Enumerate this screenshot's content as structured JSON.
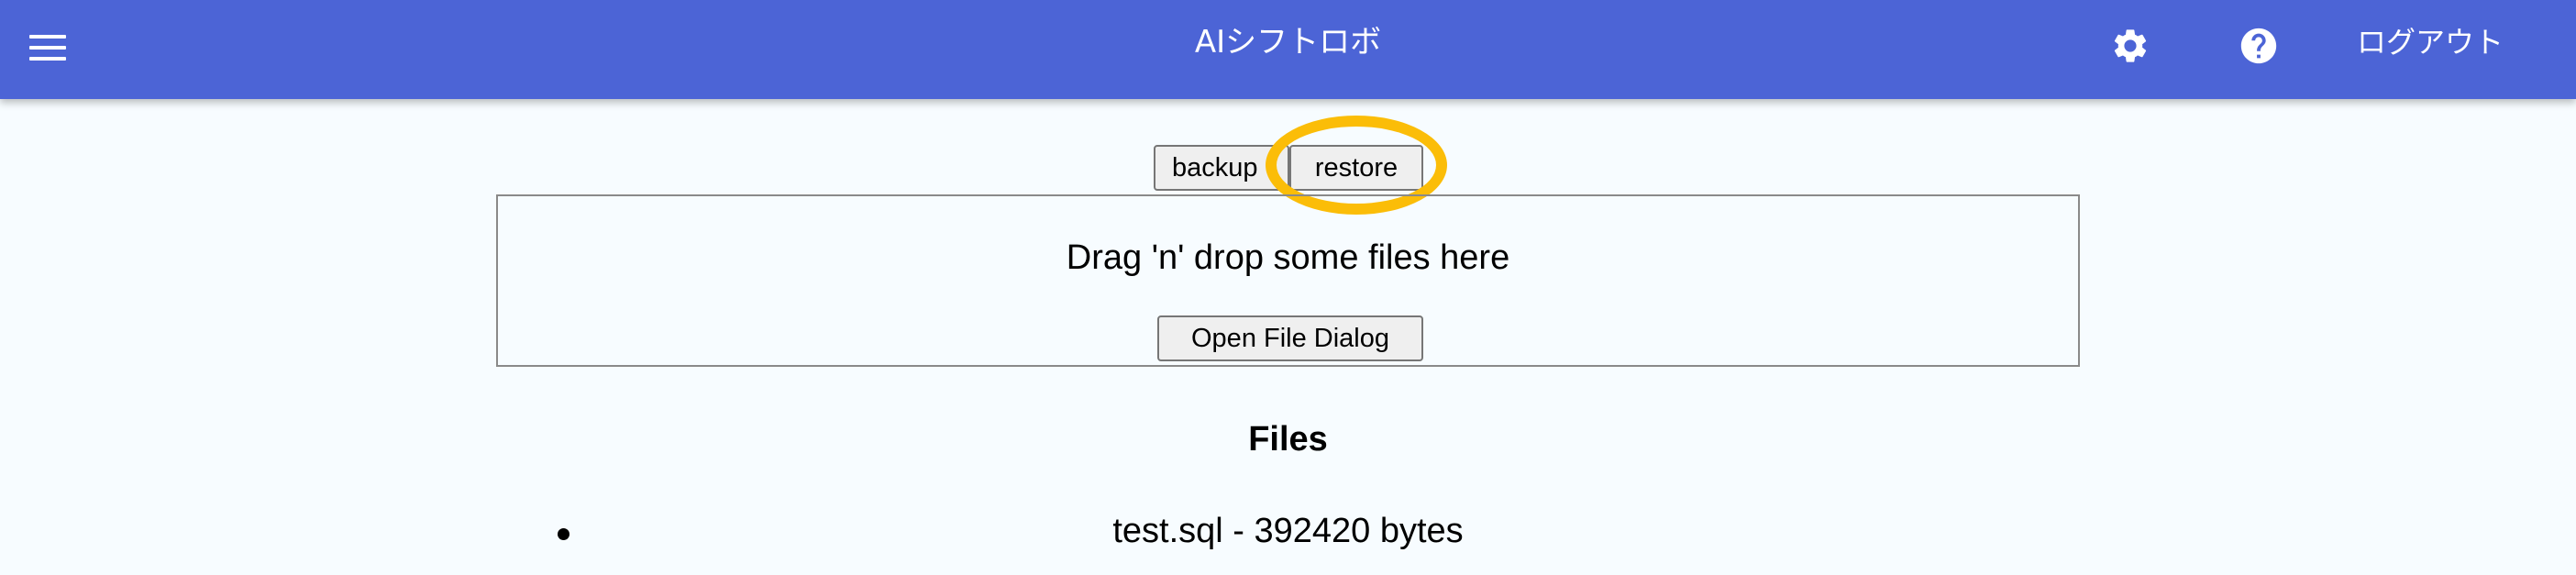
{
  "header": {
    "title": "AIシフトロボ",
    "logout_label": "ログアウト",
    "icons": {
      "menu": "menu-icon",
      "settings": "gear-icon",
      "help": "help-icon"
    },
    "color": "#4c64d6"
  },
  "actions": {
    "backup_label": "backup",
    "restore_label": "restore"
  },
  "dropzone": {
    "prompt": "Drag 'n' drop some files here",
    "open_dialog_label": "Open File Dialog"
  },
  "files": {
    "heading": "Files",
    "items": [
      {
        "label": "test.sql - 392420 bytes"
      }
    ]
  },
  "highlight": {
    "color": "#fbbd08",
    "target": "restore-button"
  }
}
